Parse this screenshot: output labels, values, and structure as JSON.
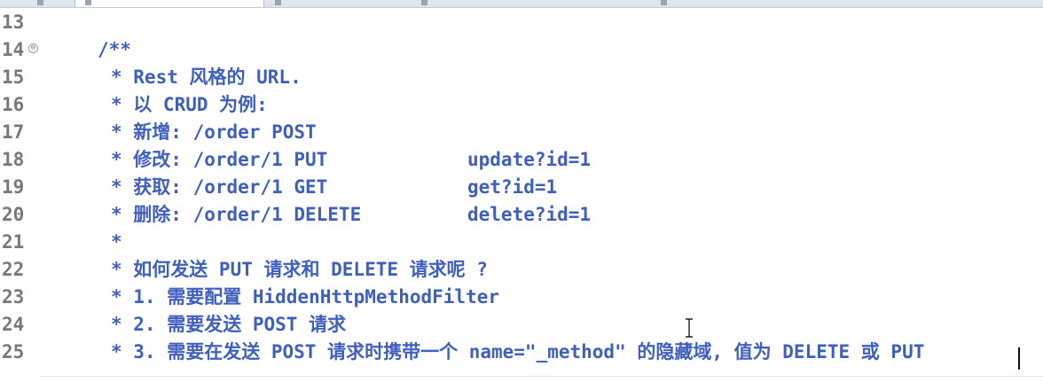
{
  "editor": {
    "lines": [
      {
        "num": "13",
        "text": ""
      },
      {
        "num": "14",
        "text": "/**"
      },
      {
        "num": "15",
        "text": "* Rest 风格的 URL."
      },
      {
        "num": "16",
        "text": "* 以 CRUD 为例:"
      },
      {
        "num": "17",
        "text": "* 新增: /order POST"
      },
      {
        "num": "18",
        "text": "* 修改: /order/1 PUT",
        "extra": "update?id=1"
      },
      {
        "num": "19",
        "text": "* 获取: /order/1 GET",
        "extra": "get?id=1"
      },
      {
        "num": "20",
        "text": "* 删除: /order/1 DELETE",
        "extra": "delete?id=1"
      },
      {
        "num": "21",
        "text": "*"
      },
      {
        "num": "22",
        "text": "* 如何发送 PUT 请求和 DELETE 请求呢 ?"
      },
      {
        "num": "23",
        "text": "* 1. 需要配置 HiddenHttpMethodFilter"
      },
      {
        "num": "24",
        "text": "* 2. 需要发送 POST 请求"
      },
      {
        "num": "25",
        "text": "* 3. 需要在发送 POST 请求时携带一个 name=\"_method\" 的隐藏域, 值为 DELETE 或 PUT"
      }
    ],
    "fold_marker": "⊖",
    "colors": {
      "comment": "#3f5fbf",
      "line_number": "#787878",
      "background": "#ffffff"
    }
  }
}
